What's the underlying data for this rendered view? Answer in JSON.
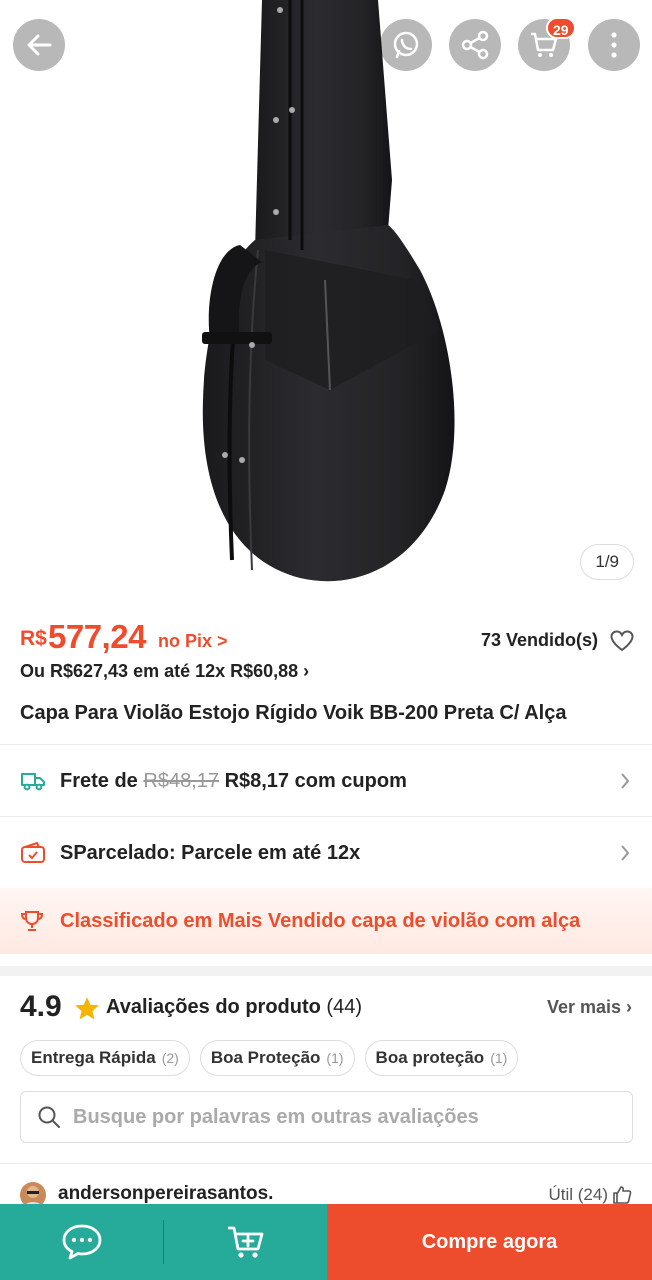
{
  "header": {
    "cart_badge": "29",
    "image_counter": "1/9"
  },
  "icons": {
    "back": "arrow-left-icon",
    "whatsapp": "whatsapp-icon",
    "share": "share-icon",
    "cart": "cart-icon",
    "more": "more-vertical-icon"
  },
  "product": {
    "currency": "R$",
    "price": "577,24",
    "pix_label": "no Pix >",
    "sold": "73 Vendido(s)",
    "installment": "Ou R$627,43 em até 12x R$60,88 ›",
    "title": "Capa Para Violão Estojo Rígido Voik BB-200 Preta C/ Alça"
  },
  "shipping": {
    "label": "Frete de",
    "old_price": "R$48,17",
    "new_price": "R$8,17 com cupom"
  },
  "sparcelado": {
    "label": "SParcelado: Parcele em até 12x"
  },
  "ranking": {
    "label": "Classificado em Mais Vendido capa de violão com alça"
  },
  "ratings": {
    "score": "4.9",
    "label": "Avaliações do produto",
    "count": "(44)",
    "see_more": "Ver mais ›",
    "chips": [
      {
        "label": "Entrega Rápida",
        "count": "(2)"
      },
      {
        "label": "Boa Proteção",
        "count": "(1)"
      },
      {
        "label": "Boa proteção",
        "count": "(1)"
      }
    ],
    "search_placeholder": "Busque por palavras em outras avaliações"
  },
  "review": {
    "reviewer": "andersonpereirasantos.",
    "useful": "Útil (24)"
  },
  "bottom_bar": {
    "buy_now": "Compre agora"
  },
  "colors": {
    "accent": "#ee4d2d",
    "teal": "#26aa99",
    "star": "#f5b400"
  }
}
